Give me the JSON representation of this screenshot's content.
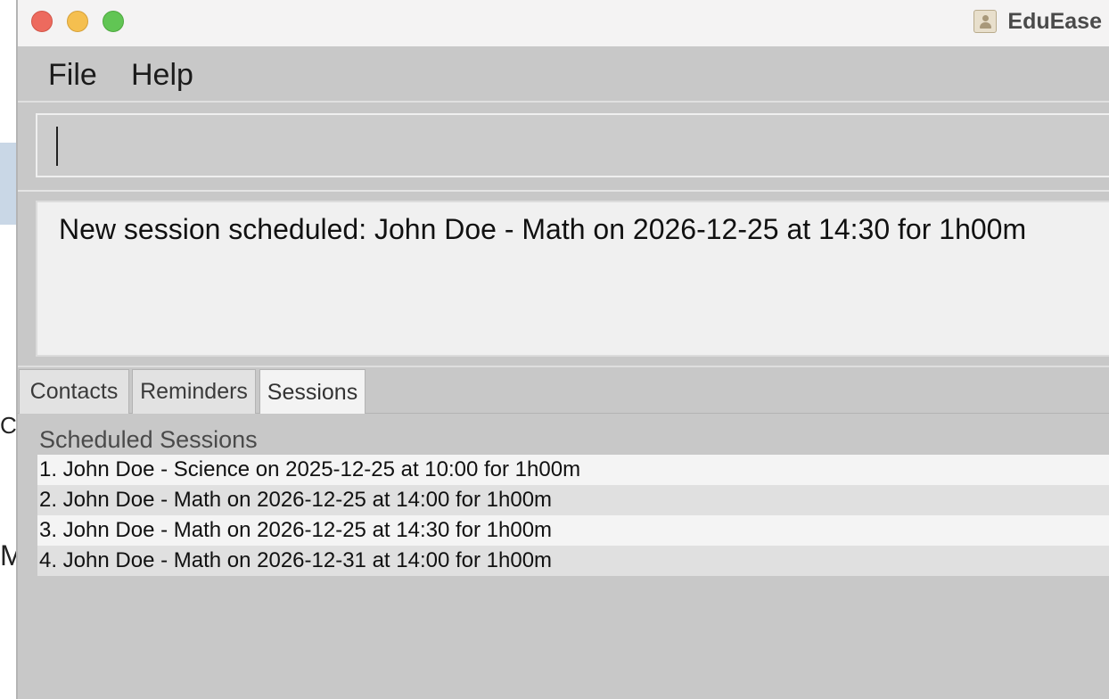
{
  "window": {
    "title": "EduEase"
  },
  "background_fragments": {
    "frag1": "CT",
    "frag2": "M"
  },
  "menu": {
    "file_label": "File",
    "help_label": "Help"
  },
  "command": {
    "value": ""
  },
  "result": {
    "message": "New session scheduled: John Doe - Math on 2026-12-25 at 14:30 for 1h00m"
  },
  "tabs": [
    {
      "label": "Contacts",
      "selected": false
    },
    {
      "label": "Reminders",
      "selected": false
    },
    {
      "label": "Sessions",
      "selected": true
    }
  ],
  "sessions": {
    "header": "Scheduled Sessions",
    "items": [
      "1. John Doe - Science on 2025-12-25 at 10:00 for 1h00m",
      "2. John Doe - Math on 2026-12-25 at 14:00 for 1h00m",
      "3. John Doe - Math on 2026-12-25 at 14:30 for 1h00m",
      "4. John Doe - Math on 2026-12-31 at 14:00 for 1h00m"
    ]
  }
}
